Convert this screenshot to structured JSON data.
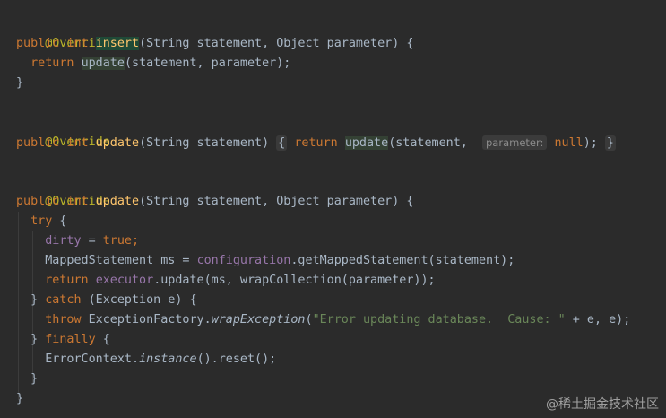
{
  "code": {
    "l1": {
      "ann": "@Override"
    },
    "l2": {
      "kw1": "public",
      "kw2": "int",
      "name": "insert",
      "rest": "(String statement, Object parameter) {"
    },
    "l3": {
      "kw": "return",
      "call": "update",
      "rest": "(statement, parameter);"
    },
    "l4": {
      "brace": "}"
    },
    "l6": {
      "ann": "@Override"
    },
    "l7": {
      "kw1": "public",
      "kw2": "int",
      "name": "update",
      "params": "(String statement)",
      "fold_open": "{",
      "kw_return": "return",
      "call": "update",
      "args1": "(statement,",
      "hint": "parameter:",
      "null": "null",
      "end": ");",
      "fold_close": "}"
    },
    "l9": {
      "ann": "@Override"
    },
    "l10": {
      "kw1": "public",
      "kw2": "int",
      "name": "update",
      "rest": "(String statement, Object parameter) {"
    },
    "l11": {
      "kw": "try",
      "rest": " {"
    },
    "l12": {
      "field": "dirty",
      "eq": " = ",
      "val": "true",
      "semi": ";"
    },
    "l13": {
      "text1": "MappedStatement ms = ",
      "field": "configuration",
      "text2": ".getMappedStatement(statement);"
    },
    "l14": {
      "kw": "return",
      "field": "executor",
      "text": ".update(ms, wrapCollection(parameter));"
    },
    "l15": {
      "b": "} ",
      "kw": "catch",
      "rest": " (Exception e) {"
    },
    "l16": {
      "kw": "throw",
      "cls": "ExceptionFactory.",
      "method": "wrapException",
      "open": "(",
      "str": "\"Error updating database.  Cause: \"",
      "rest": " + e, e);"
    },
    "l17": {
      "b": "} ",
      "kw": "finally",
      "rest": " {"
    },
    "l18": {
      "cls": "ErrorContext.",
      "method": "instance",
      "rest": "().reset();"
    },
    "l19": {
      "brace": "}"
    },
    "l20": {
      "brace": "}"
    }
  },
  "watermark": "@稀土掘金技术社区"
}
